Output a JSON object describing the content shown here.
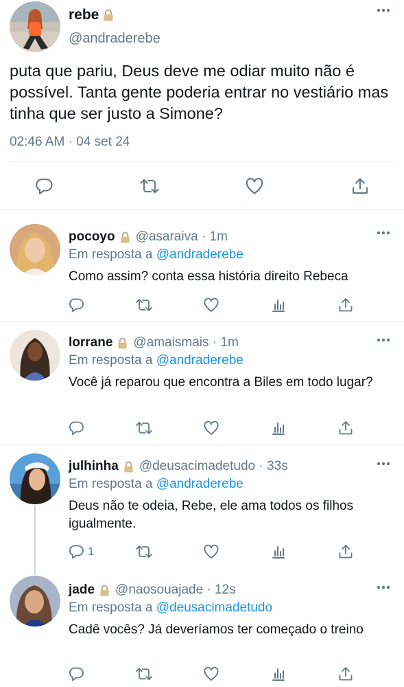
{
  "main_tweet": {
    "name": "rebe",
    "handle": "@andraderebe",
    "text": "puta que pariu, Deus deve me odiar muito não é possível. Tanta gente poderia entrar no vestiário mas tinha que ser justo a Simone?",
    "timestamp": "02:46 AM · 04 set 24"
  },
  "replies": [
    {
      "name": "pocoyo",
      "handle": "@asaraiva · 1m",
      "in_reply_prefix": "Em resposta a",
      "in_reply_to": "@andraderebe",
      "text": "Como assim? conta essa história direito Rebeca",
      "reply_count": ""
    },
    {
      "name": "lorrane",
      "handle": "@amaismais · 1m",
      "in_reply_prefix": "Em resposta a",
      "in_reply_to": "@andraderebe",
      "text": "Você já reparou que encontra a Biles em todo lugar?",
      "reply_count": ""
    },
    {
      "name": "julhinha",
      "handle": "@deusacimadetudo · 33s",
      "in_reply_prefix": "Em resposta a",
      "in_reply_to": "@andraderebe",
      "text": "Deus não te odeia, Rebe, ele ama todos os filhos igualmente.",
      "reply_count": "1"
    },
    {
      "name": "jade",
      "handle": "@naosouajade · 12s",
      "in_reply_prefix": "Em resposta a",
      "in_reply_to": "@deusacimadetudo",
      "text": "Cadê vocês? Já deveríamos ter começado o treino",
      "reply_count": ""
    }
  ],
  "icons": {
    "reply": "reply-icon",
    "retweet": "retweet-icon",
    "like": "heart-icon",
    "analytics": "analytics-icon",
    "share": "share-icon",
    "lock": "lock-icon",
    "more": "more-icon"
  },
  "colors": {
    "text": "#14171a",
    "secondary": "#657786",
    "link": "#1b95e0",
    "divider": "#e6ecf0"
  }
}
